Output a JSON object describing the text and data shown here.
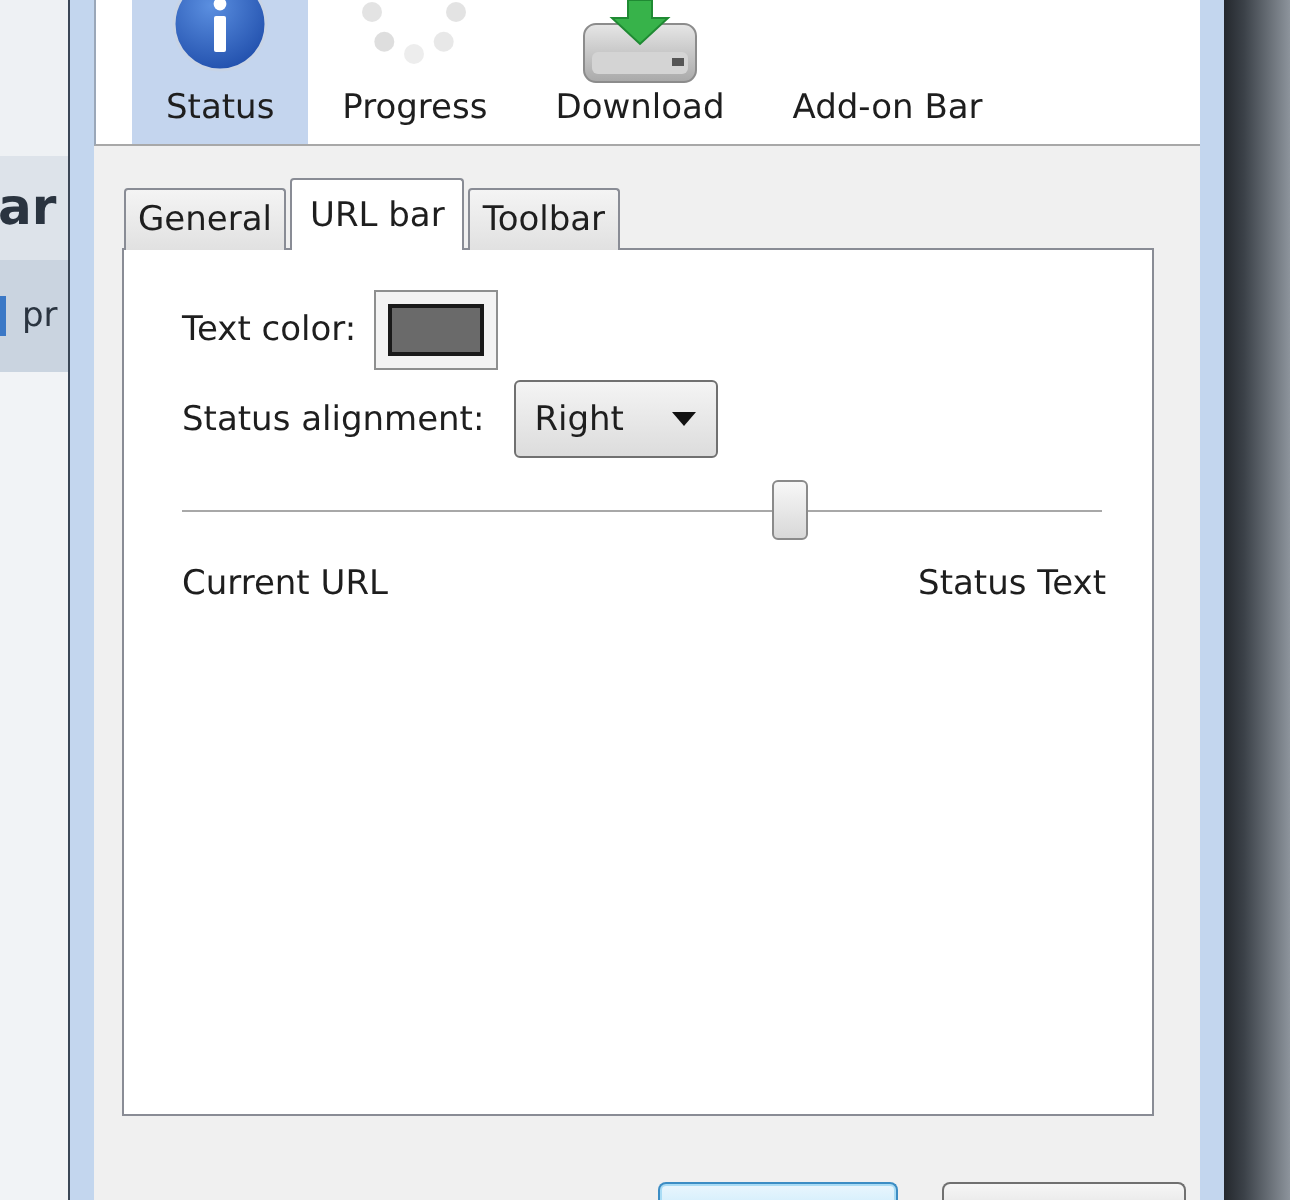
{
  "background_page": {
    "heading": "ar",
    "text": "pr"
  },
  "panes": [
    {
      "label": "Status",
      "kind": "info",
      "selected": true
    },
    {
      "label": "Progress",
      "kind": "spinner",
      "selected": false
    },
    {
      "label": "Download",
      "kind": "drive",
      "selected": false
    },
    {
      "label": "Add-on Bar",
      "kind": "plain",
      "selected": false
    }
  ],
  "tabs": [
    {
      "label": "General",
      "selected": false
    },
    {
      "label": "URL bar",
      "selected": true
    },
    {
      "label": "Toolbar",
      "selected": false
    }
  ],
  "text_color": {
    "label": "Text color:",
    "color": "#6a6a6a"
  },
  "status_alignment": {
    "label": "Status alignment:",
    "value": "Right"
  },
  "slider": {
    "level": 0.66,
    "min_label": "Current URL",
    "max_label": "Status Text"
  },
  "buttons": [
    {
      "focused": true
    },
    {
      "focused": false
    }
  ]
}
